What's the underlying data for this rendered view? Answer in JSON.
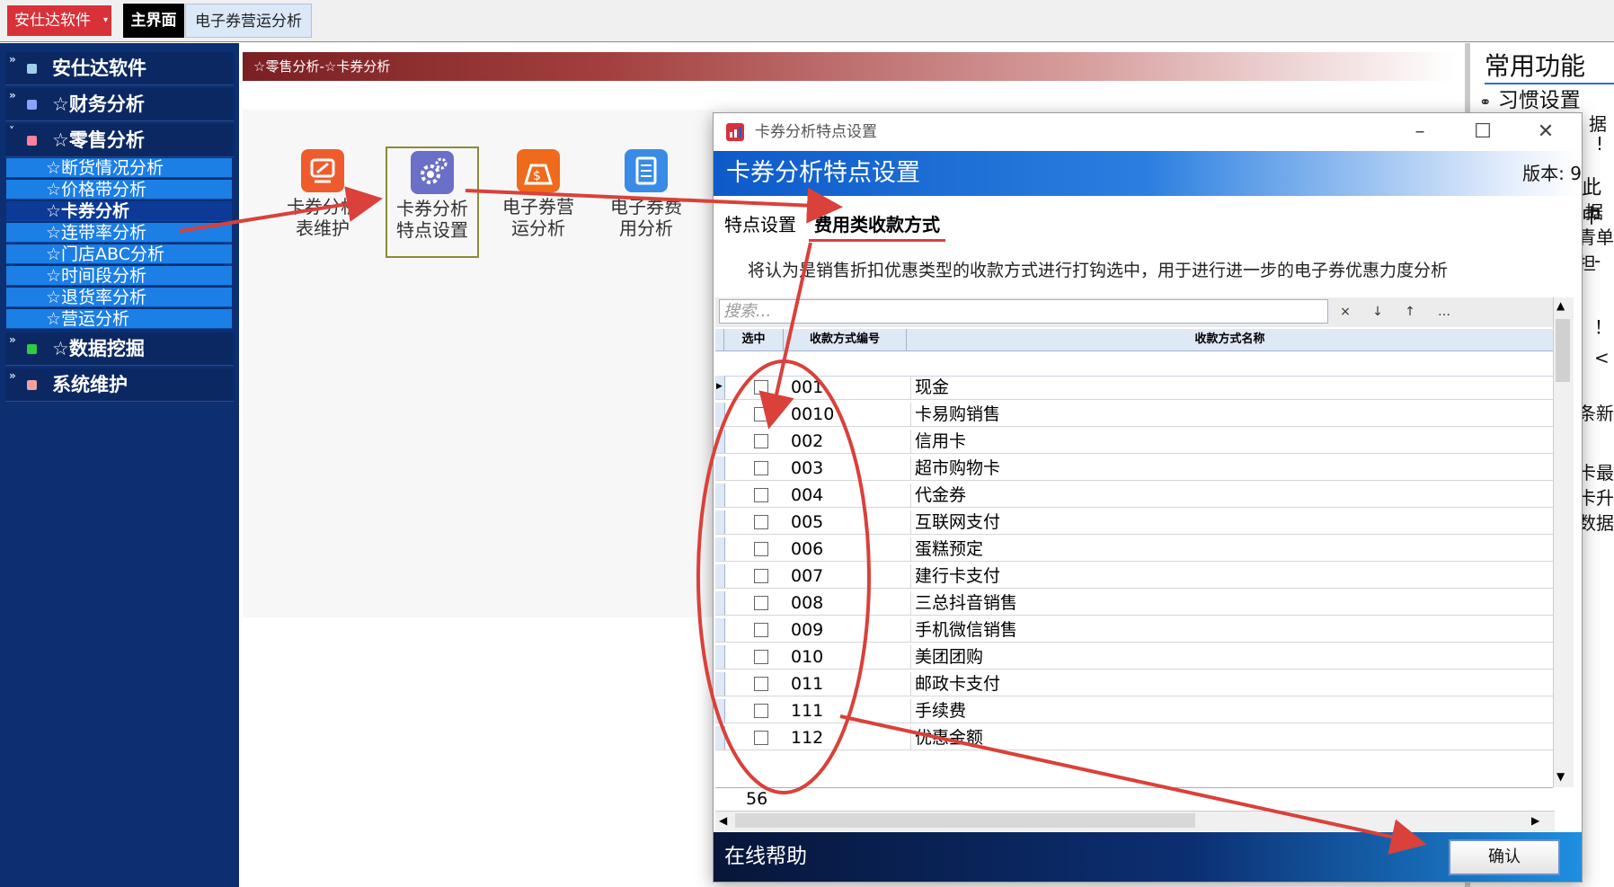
{
  "topbar": {
    "app_label": "安仕达软件",
    "app_dropdown_glyph": "▾",
    "tab_main": "主界面",
    "tab_doc": "电子券营运分析"
  },
  "sidebar": {
    "groups": [
      {
        "label": "安仕达软件",
        "color": "#9ecfe8"
      },
      {
        "label": "☆财务分析",
        "color": "#8ea0ff"
      },
      {
        "label": "☆零售分析",
        "color": "#ff7f9f"
      },
      {
        "label": "☆数据挖掘",
        "color": "#2ecc40"
      },
      {
        "label": "系统维护",
        "color": "#f3a0a0"
      }
    ],
    "retail_items": [
      "☆断货情况分析",
      "☆价格带分析",
      "☆卡券分析",
      "☆连带率分析",
      "☆门店ABC分析",
      "☆时间段分析",
      "☆退货率分析",
      "☆营运分析"
    ],
    "selected_item": "☆卡券分析"
  },
  "content": {
    "breadcrumb": "☆零售分析-☆卡券分析",
    "functions": [
      {
        "line1": "卡券分析",
        "line2": "表维护",
        "icon": "card-edit-icon",
        "color": "#ef5b2c"
      },
      {
        "line1": "卡券分析",
        "line2": "特点设置",
        "icon": "gear-icon",
        "color": "#6a6fc7"
      },
      {
        "line1": "电子券营",
        "line2": "运分析",
        "icon": "money-bag-icon",
        "color": "#ef6a1a"
      },
      {
        "line1": "电子券费",
        "line2": "用分析",
        "icon": "document-icon",
        "color": "#3a8be6"
      }
    ]
  },
  "right_panel": {
    "title": "常用功能",
    "habit": "习惯设置",
    "fragments": [
      "据",
      "!",
      "此中",
      "据",
      "青单担",
      "-",
      "！",
      "<",
      "条新",
      "卡最",
      "卡升",
      "数据"
    ]
  },
  "dialog": {
    "window_title": "卡券分析特点设置",
    "header_title": "卡券分析特点设置",
    "version": "版本: 9",
    "tabs": [
      "特点设置",
      "费用类收款方式"
    ],
    "description": "将认为是销售折扣优惠类型的收款方式进行打钩选中，用于进行进一步的电子券优惠力度分析",
    "search_placeholder": "搜索...",
    "toolbar": [
      "×",
      "↓",
      "↑",
      "…"
    ],
    "columns": [
      "选中",
      "收款方式编号",
      "收款方式名称"
    ],
    "rows": [
      {
        "code": "001",
        "name": "现金"
      },
      {
        "code": "0010",
        "name": "卡易购销售"
      },
      {
        "code": "002",
        "name": "信用卡"
      },
      {
        "code": "003",
        "name": "超市购物卡"
      },
      {
        "code": "004",
        "name": "代金券"
      },
      {
        "code": "005",
        "name": "互联网支付"
      },
      {
        "code": "006",
        "name": "蛋糕预定"
      },
      {
        "code": "007",
        "name": "建行卡支付"
      },
      {
        "code": "008",
        "name": "三总抖音销售"
      },
      {
        "code": "009",
        "name": "手机微信销售"
      },
      {
        "code": "010",
        "name": "美团团购"
      },
      {
        "code": "011",
        "name": "邮政卡支付"
      },
      {
        "code": "111",
        "name": "手续费"
      },
      {
        "code": "112",
        "name": "优惠金额"
      }
    ],
    "count": "56",
    "help": "在线帮助",
    "ok": "确认"
  },
  "colors": {
    "annotation": "#d9413a",
    "accent": "#1b7fe5"
  }
}
